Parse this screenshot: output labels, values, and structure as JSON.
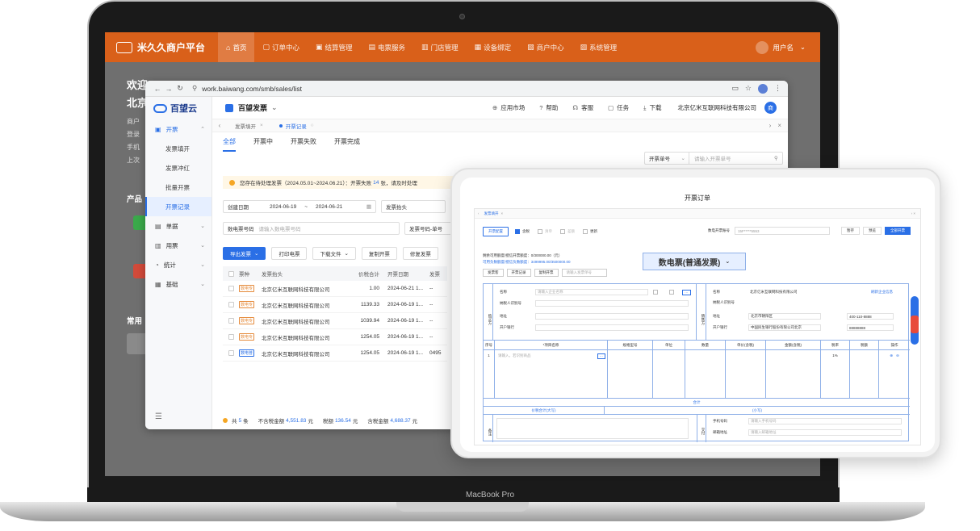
{
  "device": {
    "label": "MacBook Pro"
  },
  "merchant": {
    "brand": "米久久商户平台",
    "nav": [
      {
        "label": "首页",
        "icon": "home-icon",
        "active": true
      },
      {
        "label": "订单中心",
        "icon": "order-icon"
      },
      {
        "label": "结算管理",
        "icon": "settle-icon"
      },
      {
        "label": "电票服务",
        "icon": "invoice-icon"
      },
      {
        "label": "门店管理",
        "icon": "store-icon"
      },
      {
        "label": "设备绑定",
        "icon": "device-icon"
      },
      {
        "label": "商户中心",
        "icon": "merchant-icon"
      },
      {
        "label": "系统管理",
        "icon": "system-icon"
      }
    ],
    "user": "用户名",
    "welcome_1": "欢迎",
    "welcome_2": "北京",
    "side_lines": [
      "商户",
      "登录",
      "手机",
      "上次"
    ],
    "section_products": "产品",
    "section_common": "常用"
  },
  "browser": {
    "url": "work.baiwang.com/smb/sales/list"
  },
  "app": {
    "logo": "百望云",
    "product": "百望发票",
    "menu": {
      "parent": "开票",
      "children": [
        "发票填开",
        "发票冲红",
        "批量开票",
        "开票记录"
      ],
      "others": [
        "单据",
        "用票",
        "统计",
        "基础"
      ]
    },
    "header_actions": [
      "应用市场",
      "帮助",
      "客服",
      "任务",
      "下载"
    ],
    "company": "北京亿米互联网科技有限公司",
    "avatar": "商",
    "tabs": [
      {
        "label": "发票填开"
      },
      {
        "label": "开票记录",
        "active": true
      }
    ],
    "status_tabs": [
      "全部",
      "开票中",
      "开票失败",
      "开票完成"
    ],
    "search": {
      "field": "开票单号",
      "placeholder": "请输入开票单号"
    },
    "notice": {
      "pre": "您存在待处理发票（2024.05.01~2024.06.21）：开票失败",
      "count": "14",
      "post": "张，请及时处理"
    },
    "filters": {
      "date_label": "创建日期",
      "date_from": "2024-06-19",
      "date_to": "2024-06-21",
      "title_label": "发票抬头",
      "einv_label": "数电票号码",
      "einv_placeholder": "请输入数电票号码",
      "code_label": "发票号码-单号"
    },
    "buttons": [
      "导出发票",
      "打印电票",
      "下载文件",
      "复制开票",
      "修复发票"
    ],
    "columns": [
      "票种",
      "发票抬头",
      "价税合计",
      "开票日期",
      "发票"
    ],
    "rows": [
      {
        "type": "数电专",
        "title": "北京亿米互联网科技有限公司",
        "amount": "1.00",
        "date": "2024-06-21 1...",
        "no": "--"
      },
      {
        "type": "数电专",
        "title": "北京亿米互联网科技有限公司",
        "amount": "1139.33",
        "date": "2024-06-19 1...",
        "no": "--"
      },
      {
        "type": "数电专",
        "title": "北京亿米互联网科技有限公司",
        "amount": "1039.94",
        "date": "2024-06-19 1...",
        "no": "--"
      },
      {
        "type": "数电专",
        "title": "北京亿米互联网科技有限公司",
        "amount": "1254.05",
        "date": "2024-06-19 1...",
        "no": "--"
      },
      {
        "type": "数电普",
        "title": "北京亿米互联网科技有限公司",
        "amount": "1254.05",
        "date": "2024-06-19 1...",
        "no": "0495"
      }
    ],
    "footer": {
      "total_pre": "共",
      "total": "5",
      "total_post": "条",
      "notax_label": "不含税金额",
      "notax": "4,551.83",
      "tax_label": "税额",
      "tax": "136.54",
      "withtax_label": "含税金额",
      "withtax": "4,688.37",
      "unit": "元"
    }
  },
  "card": {
    "title": "开票订单",
    "tab": "发票填开",
    "config_btn": "开票配置",
    "opts": [
      "含税",
      "清单",
      "差额",
      "更新"
    ],
    "einv_label": "数电开票账号",
    "einv_value": "15F*****5553",
    "actions": [
      "暂存",
      "预览",
      "全部开票"
    ],
    "quota_1": "剩余可用额度/授信开票额度：0/300000.00（元）",
    "quota_2": "可用负数额度/授信负数额度：3499995.00/3500000.00",
    "small_btns": [
      "发票客",
      "开票记录",
      "复制开票"
    ],
    "small_ph": "请输入发票单号",
    "invoice_type": "数电票(普通发票)",
    "buyer_label": "购买方",
    "seller_label": "销售方",
    "buyer_fields": [
      {
        "k": "名称",
        "v": "请输入企业名称"
      },
      {
        "k": "纳税人识别号",
        "v": ""
      },
      {
        "k": "地址",
        "v": ""
      },
      {
        "k": "开户银行",
        "v": ""
      }
    ],
    "seller_fields": [
      {
        "k": "名称",
        "v": "北京亿米互联网科技有限公司"
      },
      {
        "k": "纳税人识别号",
        "v": ""
      },
      {
        "k": "地址",
        "v": "北京市朝阳区"
      },
      {
        "k": "开户银行",
        "v": "中国民生银行股份有限公司北京"
      }
    ],
    "seller_phone": "400-110-8888",
    "seller_account": "88888888",
    "refresh": "刷新企业信息",
    "cols": [
      "序号",
      "*项目名称",
      "规格型号",
      "单位",
      "数量",
      "单价(含税)",
      "金额(含税)",
      "税率",
      "税额",
      "操作"
    ],
    "row_no": "1",
    "row_ph": "请输入，若识别商品",
    "row_rate": "1%",
    "sum": "合计",
    "sum_cap": "价税合计(大写)",
    "sum_small": "(小写)",
    "remark": "备注",
    "payee_labels": [
      "手机号码",
      "邮箱地址"
    ],
    "payee_ph": [
      "请输入手机号码",
      "请输入邮箱地址"
    ],
    "payee": "交付"
  }
}
